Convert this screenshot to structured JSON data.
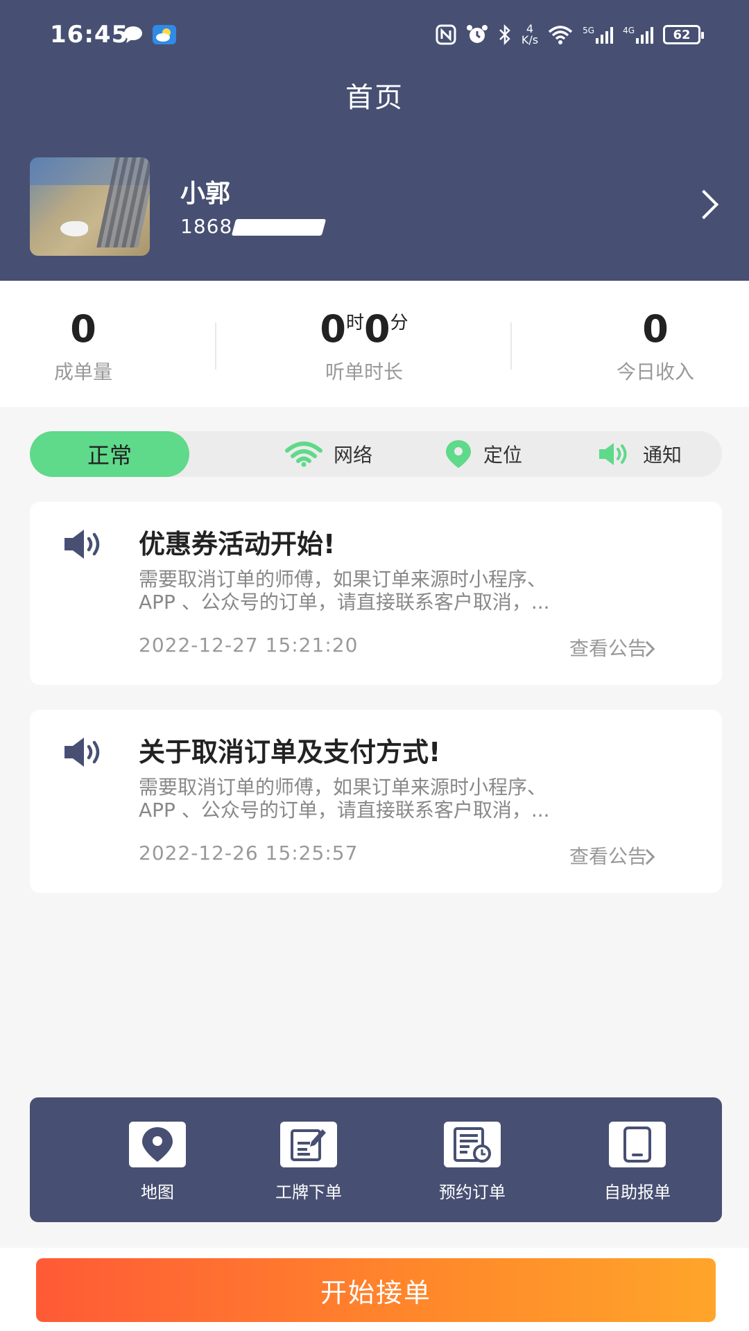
{
  "status_bar": {
    "time": "16:45",
    "net_speed_value": "4",
    "net_speed_unit": "K/s",
    "signal_1_tech": "5G",
    "signal_2_tech": "4G",
    "battery": "62",
    "icons": [
      "message-icon",
      "weather-icon",
      "nfc-icon",
      "alarm-icon",
      "bluetooth-icon",
      "wifi-icon",
      "battery-icon"
    ]
  },
  "header": {
    "title": "首页",
    "user_name": "小郭",
    "user_phone_prefix": "1868"
  },
  "stats": {
    "orders_value": "0",
    "orders_label": "成单量",
    "listen_hours": "0",
    "listen_hours_unit": "时",
    "listen_minutes": "0",
    "listen_minutes_unit": "分",
    "listen_label": "听单时长",
    "income_value": "0",
    "income_label": "今日收入"
  },
  "status": {
    "normal": "正常",
    "network": "网络",
    "location": "定位",
    "notify": "通知",
    "green": "#5fd98a"
  },
  "notices": [
    {
      "title": "优惠券活动开始!",
      "line1": "需要取消订单的师傅，如果订单来源时小程序、",
      "line2": "APP 、公众号的订单，请直接联系客户取消，...",
      "date": "2022-12-27 15:21:20",
      "link": "查看公告"
    },
    {
      "title": "关于取消订单及支付方式!",
      "line1": "需要取消订单的师傅，如果订单来源时小程序、",
      "line2": "APP 、公众号的订单，请直接联系客户取消，...",
      "date": "2022-12-26 15:25:57",
      "link": "查看公告"
    }
  ],
  "toolbar": {
    "map": "地图",
    "badge_order": "工牌下单",
    "reserve_order": "预约订单",
    "self_report": "自助报单"
  },
  "start_button": "开始接单",
  "colors": {
    "header_bg": "#475072",
    "accent_orange": "#ff5a36"
  }
}
